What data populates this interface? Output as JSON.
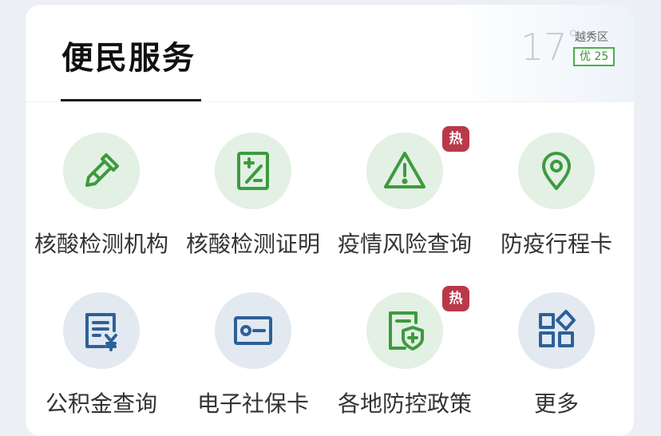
{
  "header": {
    "title": "便民服务",
    "weather": {
      "temperature": "17",
      "degree_symbol": "°",
      "district": "越秀区",
      "aqi_label": "优 25"
    }
  },
  "badge_text": "热",
  "services": [
    {
      "label": "核酸检测机构",
      "icon": "dropper-icon",
      "hot": false
    },
    {
      "label": "核酸检测证明",
      "icon": "certificate-icon",
      "hot": false
    },
    {
      "label": "疫情风险查询",
      "icon": "warning-icon",
      "hot": true
    },
    {
      "label": "防疫行程卡",
      "icon": "location-pin-icon",
      "hot": false
    },
    {
      "label": "公积金查询",
      "icon": "document-yen-icon",
      "hot": false
    },
    {
      "label": "电子社保卡",
      "icon": "id-card-icon",
      "hot": false
    },
    {
      "label": "各地防控政策",
      "icon": "shield-plus-icon",
      "hot": true
    },
    {
      "label": "更多",
      "icon": "grid-icon",
      "hot": false
    }
  ],
  "colors": {
    "green_icon": "#3c9b3e",
    "blue_icon": "#2d6099",
    "hot_badge": "#b8394a",
    "aqi_border": "#47b04b"
  }
}
